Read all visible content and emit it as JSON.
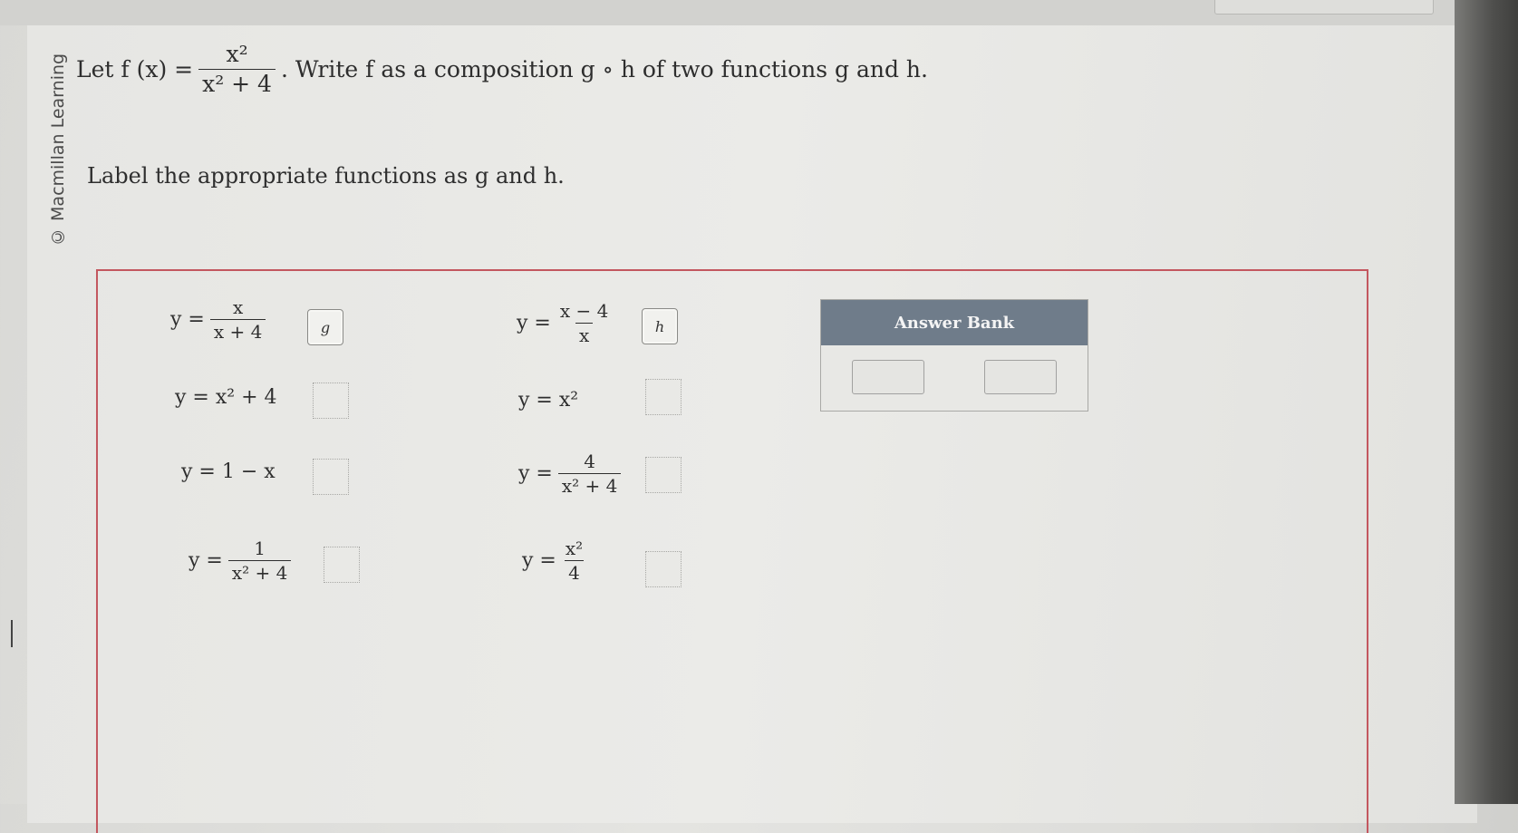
{
  "watermark": "© Macmillan Learning",
  "question": {
    "prefix": "Let f (x) =",
    "frac_num": "x²",
    "frac_den": "x² + 4",
    "suffix": ". Write f as a composition g ∘ h of two functions g and h."
  },
  "instruction": "Label the appropriate functions as g and h.",
  "left_items": [
    {
      "lhs": "y =",
      "num": "x",
      "den": "x + 4",
      "slot": "g"
    },
    {
      "expr": "y = x² + 4",
      "slot": ""
    },
    {
      "expr": "y = 1 − x",
      "slot": ""
    },
    {
      "lhs": "y =",
      "num": "1",
      "den": "x² + 4",
      "slot": ""
    }
  ],
  "right_items": [
    {
      "lhs": "y =",
      "num": "x − 4",
      "den": "x",
      "slot": "h"
    },
    {
      "expr": "y = x²",
      "slot": ""
    },
    {
      "lhs": "y =",
      "num": "4",
      "den": "x² + 4",
      "slot": ""
    },
    {
      "lhs": "y =",
      "num": "x²",
      "den": "4",
      "slot": ""
    }
  ],
  "answer_bank": {
    "title": "Answer Bank"
  }
}
